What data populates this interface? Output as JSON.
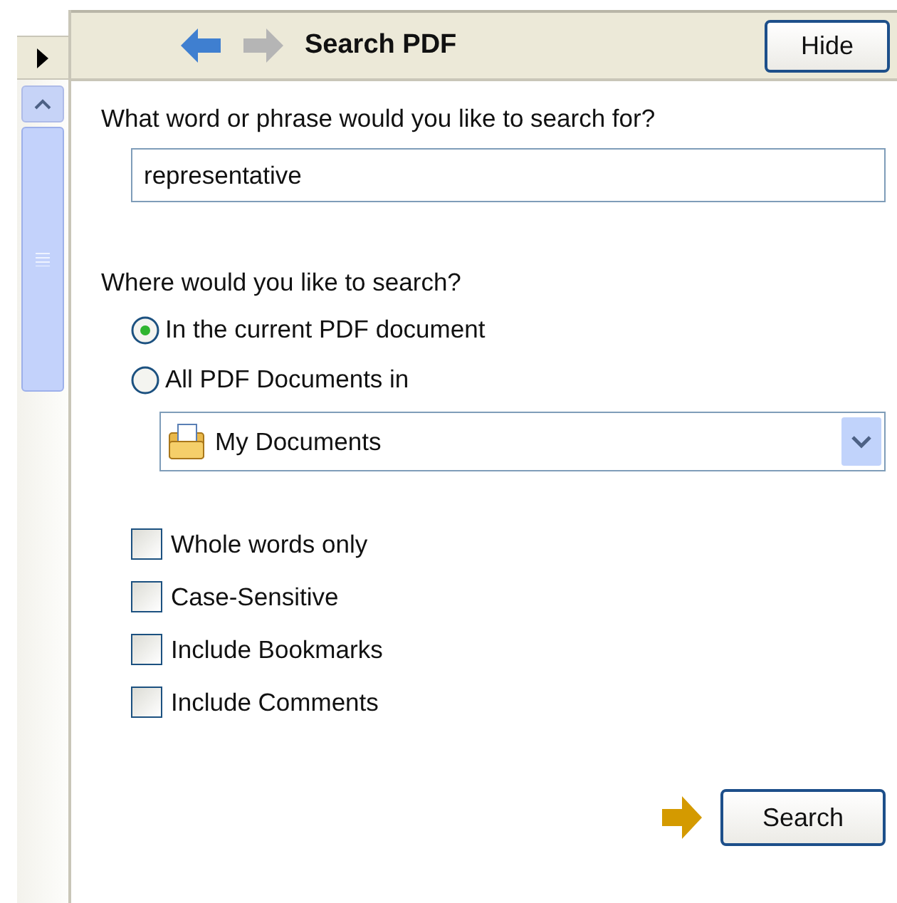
{
  "header": {
    "title": "Search PDF",
    "back_enabled": true,
    "forward_enabled": false,
    "hide_button": "Hide"
  },
  "query": {
    "label": "What word or phrase would you like to search for?",
    "value": "representative"
  },
  "scope": {
    "label": "Where would you like to search?",
    "options": [
      {
        "label": "In the current PDF document",
        "selected": true
      },
      {
        "label": "All PDF Documents in",
        "selected": false
      }
    ],
    "folder": "My Documents"
  },
  "options": [
    {
      "label": "Whole words only",
      "checked": false
    },
    {
      "label": "Case-Sensitive",
      "checked": false
    },
    {
      "label": "Include Bookmarks",
      "checked": false
    },
    {
      "label": "Include Comments",
      "checked": false
    }
  ],
  "search_button": "Search"
}
